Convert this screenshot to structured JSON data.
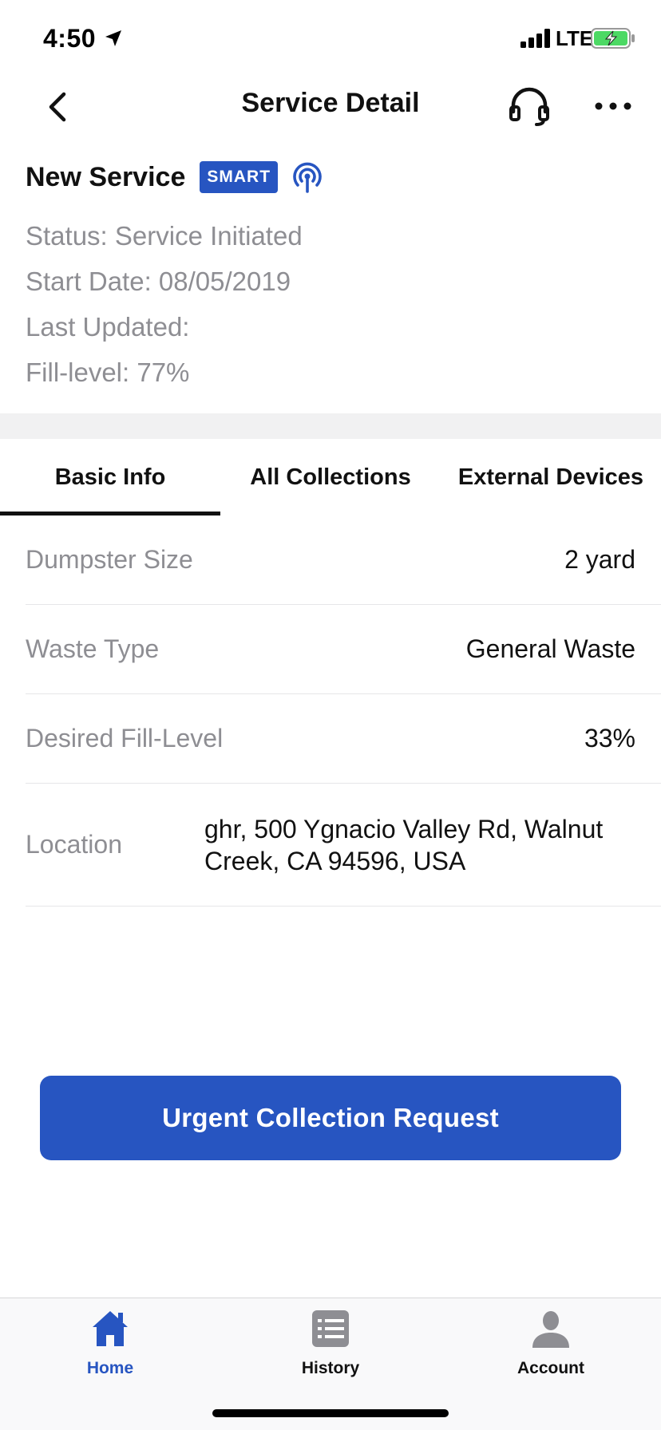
{
  "status_bar": {
    "time": "4:50",
    "network": "LTE"
  },
  "nav": {
    "title": "Service Detail",
    "icons": [
      "chevron-left-icon",
      "headset-icon",
      "more-horizontal-icon"
    ]
  },
  "service": {
    "name": "New Service",
    "badge": "SMART",
    "status": "Status: Service Initiated",
    "start_date": "Start Date: 08/05/2019",
    "last_updated": "Last Updated:",
    "fill_level": "Fill-level: 77%"
  },
  "tabs": [
    {
      "label": "Basic Info",
      "active": true
    },
    {
      "label": "All Collections",
      "active": false
    },
    {
      "label": "External Devices",
      "active": false
    }
  ],
  "details": {
    "dumpster_size": {
      "label": "Dumpster Size",
      "value": "2 yard"
    },
    "waste_type": {
      "label": "Waste Type",
      "value": "General Waste"
    },
    "desired_fill": {
      "label": "Desired Fill-Level",
      "value": "33%"
    },
    "location": {
      "label": "Location",
      "value": "ghr, 500 Ygnacio Valley Rd, Walnut Creek, CA 94596, USA"
    }
  },
  "cta": {
    "label": "Urgent Collection Request"
  },
  "tabbar": {
    "items": [
      {
        "label": "Home",
        "icon": "home-icon",
        "active": true
      },
      {
        "label": "History",
        "icon": "list-icon",
        "active": false
      },
      {
        "label": "Account",
        "icon": "person-icon",
        "active": false
      }
    ]
  },
  "colors": {
    "accent": "#2755c1",
    "secondary_text": "#8e8e93",
    "battery_fill": "#4cd964"
  }
}
